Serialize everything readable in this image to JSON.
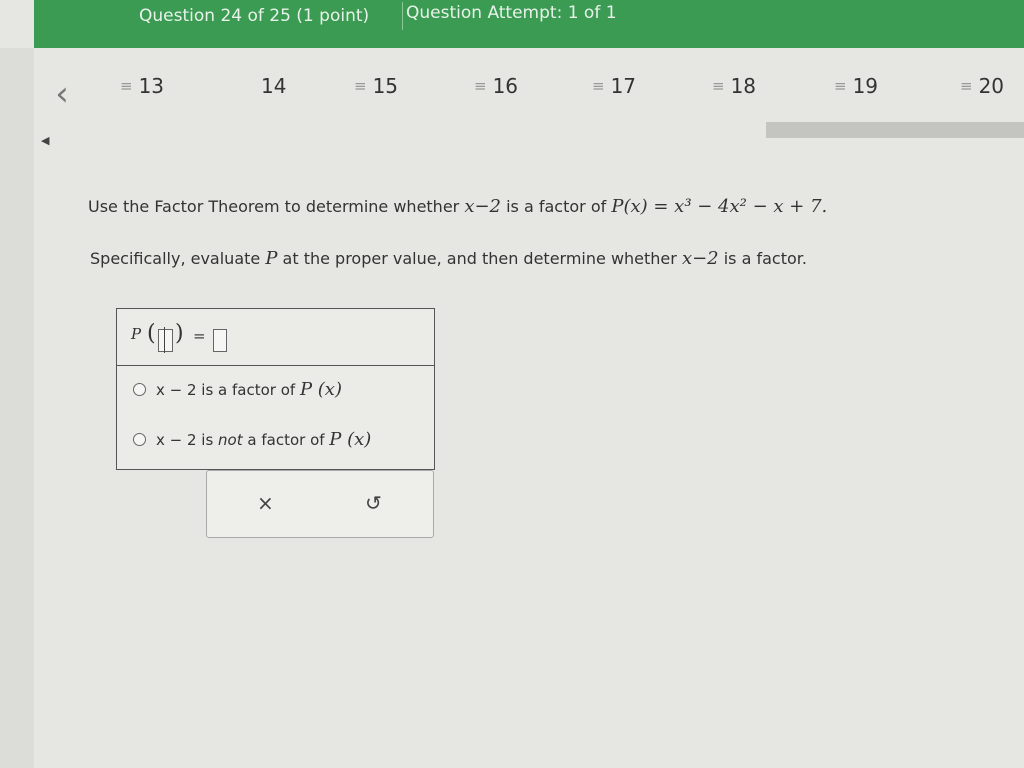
{
  "header": {
    "question_label": "Question 24 of 25 (1 point)",
    "attempt_label": "Question Attempt: 1 of 1",
    "bar_color": "#3b9b53"
  },
  "nav": {
    "back_icon": "chevron-left-icon",
    "questions": [
      {
        "num": "13",
        "answered": true
      },
      {
        "num": "14",
        "answered": false
      },
      {
        "num": "15",
        "answered": true
      },
      {
        "num": "16",
        "answered": true
      },
      {
        "num": "17",
        "answered": true
      },
      {
        "num": "18",
        "answered": true
      },
      {
        "num": "19",
        "answered": true
      },
      {
        "num": "20",
        "answered": true
      }
    ],
    "answered_icon": "≡"
  },
  "question": {
    "line1_prefix": "Use the Factor Theorem to determine whether ",
    "line1_factor": "x−2",
    "line1_mid": " is a factor of ",
    "line1_poly": "P(x) = x³ − 4x² − x + 7.",
    "line2_prefix": "Specifically, evaluate ",
    "line2_P": "P",
    "line2_mid": " at the proper value, and then determine whether ",
    "line2_factor": "x−2",
    "line2_suffix": " is a factor."
  },
  "answer": {
    "p_label": "P",
    "equals": "=",
    "option1_pre": "x − 2 is a factor of ",
    "option1_fx": "P (x)",
    "option2_pre": "x − 2 is ",
    "option2_not": "not",
    "option2_post": " a factor of ",
    "option2_fx": "P (x)"
  },
  "tools": {
    "clear_icon": "×",
    "undo_icon": "↺"
  }
}
